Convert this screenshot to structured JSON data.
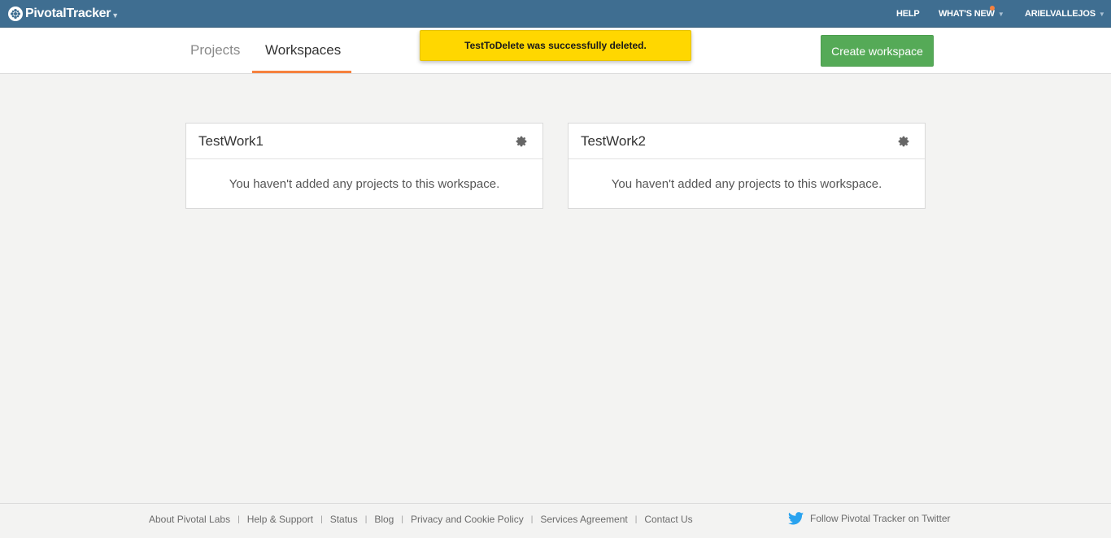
{
  "app": {
    "logo_text": "PivotalTracker",
    "logo_icon": "pivotal-tracker-logo"
  },
  "topnav": {
    "help": "HELP",
    "whats_new": "WHAT'S NEW",
    "user": "ARIELVALLEJOS"
  },
  "tabs": {
    "projects": "Projects",
    "workspaces": "Workspaces",
    "active": "Workspaces"
  },
  "actions": {
    "create_workspace": "Create workspace"
  },
  "toast": {
    "message": "TestToDelete was successfully deleted."
  },
  "workspaces": [
    {
      "name": "TestWork1",
      "empty_message": "You haven't added any projects to this workspace."
    },
    {
      "name": "TestWork2",
      "empty_message": "You haven't added any projects to this workspace."
    }
  ],
  "footer": {
    "links": [
      "About Pivotal Labs",
      "Help & Support",
      "Status",
      "Blog",
      "Privacy and Cookie Policy",
      "Services Agreement",
      "Contact Us"
    ],
    "twitter": "Follow Pivotal Tracker on Twitter"
  },
  "colors": {
    "topbar": "#3f6e91",
    "accent_tab": "#f6813e",
    "create_button": "#55aa57",
    "toast": "#ffd700"
  }
}
